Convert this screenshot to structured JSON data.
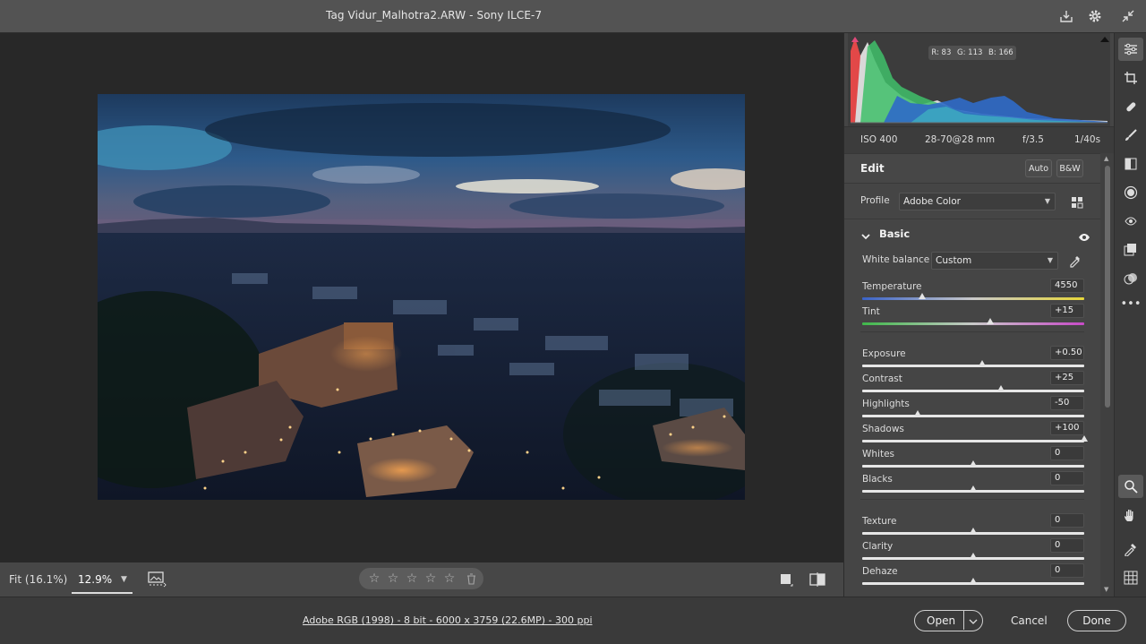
{
  "titlebar": {
    "title": "Tag Vidur_Malhotra2.ARW  -  Sony ILCE-7",
    "icons": [
      "save-download-icon",
      "gear-icon",
      "collapse-icon"
    ]
  },
  "canvas_bar": {
    "fit_label": "Fit (16.1%)",
    "zoom_value": "12.9%",
    "rating_stars": 0
  },
  "footer": {
    "image_info": "Adobe RGB (1998) - 8 bit - 6000 x 3759 (22.6MP) - 300 ppi",
    "open_label": "Open",
    "cancel_label": "Cancel",
    "done_label": "Done"
  },
  "histogram": {
    "r_label": "R:",
    "r_value": "83",
    "g_label": "G:",
    "g_value": "113",
    "b_label": "B:",
    "b_value": "166"
  },
  "camera_meta": {
    "iso": "ISO 400",
    "lens": "28-70@28 mm",
    "aperture": "f/3.5",
    "shutter": "1/40s"
  },
  "edit": {
    "title": "Edit",
    "auto_label": "Auto",
    "bw_label": "B&W",
    "profile_label": "Profile",
    "profile_value": "Adobe Color"
  },
  "basic": {
    "title": "Basic",
    "wb_label": "White balance",
    "wb_value": "Custom",
    "sliders": [
      {
        "label": "Temperature",
        "value": "4550",
        "pos": 0.27
      },
      {
        "label": "Tint",
        "value": "+15",
        "pos": 0.575
      },
      {
        "label": "Exposure",
        "value": "+0.50",
        "pos": 0.54
      },
      {
        "label": "Contrast",
        "value": "+25",
        "pos": 0.625
      },
      {
        "label": "Highlights",
        "value": "-50",
        "pos": 0.25
      },
      {
        "label": "Shadows",
        "value": "+100",
        "pos": 1.0
      },
      {
        "label": "Whites",
        "value": "0",
        "pos": 0.5
      },
      {
        "label": "Blacks",
        "value": "0",
        "pos": 0.5
      },
      {
        "label": "Texture",
        "value": "0",
        "pos": 0.5
      },
      {
        "label": "Clarity",
        "value": "0",
        "pos": 0.5
      },
      {
        "label": "Dehaze",
        "value": "0",
        "pos": 0.5
      }
    ]
  },
  "rail": {
    "icons": [
      "edit-sliders-icon",
      "crop-icon",
      "healing-icon",
      "brush-icon",
      "linear-gradient-icon",
      "radial-gradient-icon",
      "red-eye-icon",
      "snapshots-icon",
      "presets-icon",
      "more-icon",
      "zoom-icon",
      "hand-icon",
      "color-sampler-icon",
      "grid-icon"
    ]
  }
}
